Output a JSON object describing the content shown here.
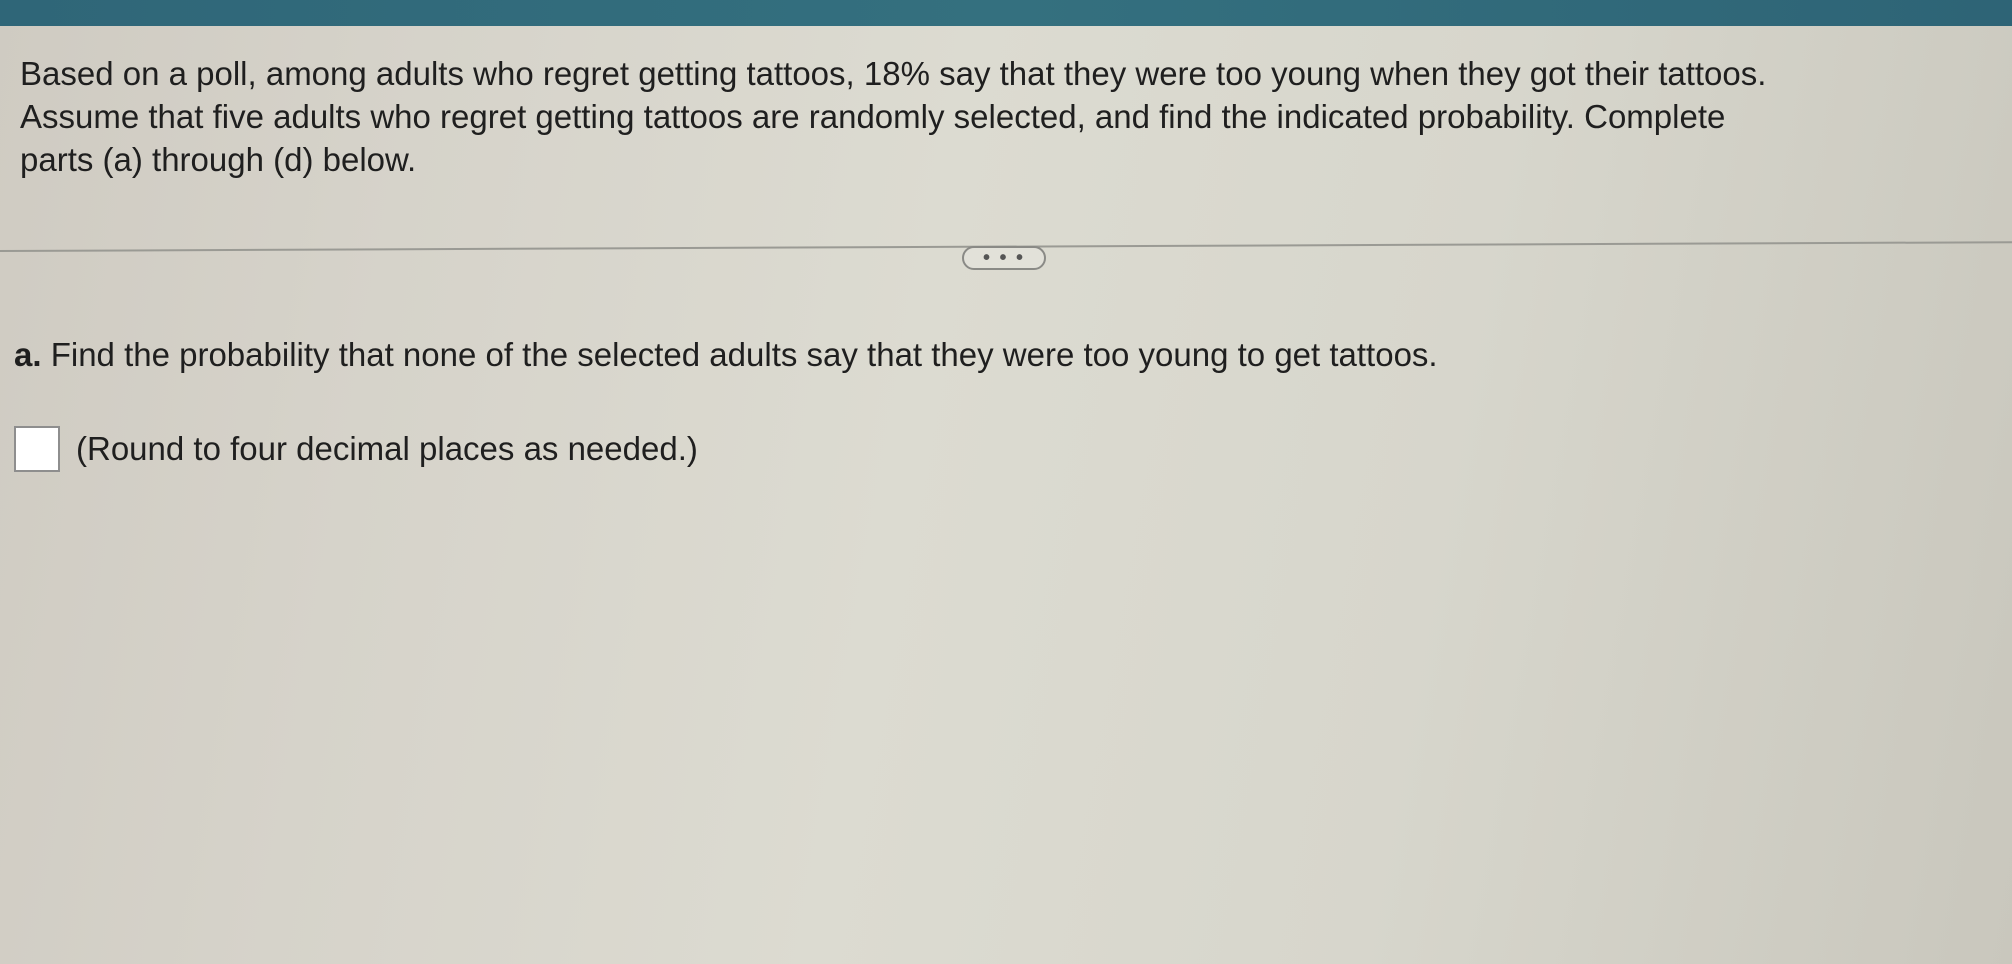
{
  "question": {
    "stem_line1": "Based on a poll, among adults who regret getting tattoos, 18% say that they were too young when they got their tattoos.",
    "stem_line2": "Assume that five adults who regret getting tattoos are randomly selected, and find the indicated probability. Complete",
    "stem_line3": "parts (a) through (d) below."
  },
  "expand_button": {
    "label": "• • •"
  },
  "part_a": {
    "letter": "a.",
    "prompt": "Find the probability that none of the selected adults say that they were too young to get tattoos.",
    "answer_value": "",
    "hint": "(Round to four decimal places as needed.)"
  },
  "colors": {
    "top_bar": "#34707f",
    "background": "#d8d6cc",
    "text": "#1f1f1f"
  }
}
